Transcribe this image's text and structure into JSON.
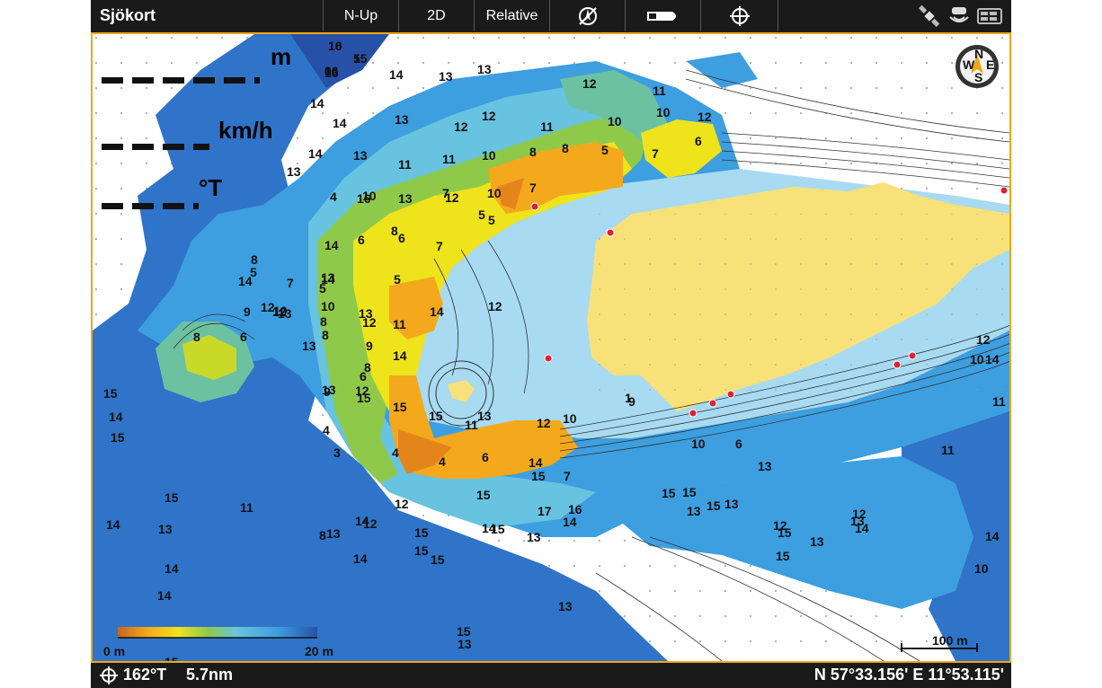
{
  "topbar": {
    "title": "Sjökort",
    "orientation_label": "N-Up",
    "view_label": "2D",
    "motion_label": "Relative",
    "icons": [
      "navigation-off-icon",
      "boat-icon",
      "crosshair-icon",
      "satellite-icon",
      "sonar-icon",
      "battery-icon"
    ]
  },
  "overlay": {
    "depth_unit": "m",
    "speed_unit": "km/h",
    "heading_unit": "°T"
  },
  "legend": {
    "min_label": "0 m",
    "max_label": "20 m",
    "colors": [
      "#c8641e",
      "#e4851c",
      "#f4a81c",
      "#f4c71c",
      "#efe31c",
      "#c9d92a",
      "#8fc94a",
      "#6cc2a0",
      "#67c3e0",
      "#3d9ee0",
      "#2f74c8",
      "#2751a8"
    ]
  },
  "scale": {
    "label": "100 m"
  },
  "statusbar": {
    "bearing": "162°T",
    "distance": "5.7nm",
    "position": "N 57°33.156' E 11°53.115'"
  },
  "compass": {
    "letters": [
      "N",
      "E",
      "S",
      "W"
    ]
  },
  "depth_labels": [
    "16",
    "16",
    "15",
    "16",
    "14",
    "13",
    "13",
    "12",
    "11",
    "14",
    "13",
    "12",
    "12",
    "11",
    "10",
    "10",
    "14",
    "14",
    "13",
    "11",
    "10",
    "8",
    "8",
    "5",
    "7",
    "6",
    "13",
    "11",
    "10",
    "7",
    "5",
    "4",
    "16",
    "13",
    "12",
    "10",
    "7",
    "5",
    "6",
    "6",
    "7",
    "8",
    "7",
    "14",
    "13",
    "10",
    "14",
    "13",
    "12",
    "8",
    "5",
    "13",
    "9",
    "8",
    "5",
    "14",
    "12",
    "13",
    "10",
    "9",
    "8",
    "6",
    "8",
    "8",
    "12",
    "11",
    "12",
    "5",
    "14",
    "14",
    "13",
    "12",
    "9",
    "6",
    "15",
    "15",
    "15",
    "13",
    "12",
    "10",
    "4",
    "3",
    "4",
    "4",
    "6",
    "14",
    "15",
    "7",
    "11",
    "8",
    "12",
    "12",
    "14",
    "15",
    "14",
    "13",
    "13",
    "15",
    "17",
    "16",
    "15",
    "14",
    "14",
    "15",
    "15",
    "14",
    "13",
    "13",
    "13",
    "15",
    "15",
    "14",
    "15",
    "15",
    "14",
    "14",
    "15",
    "15",
    "15",
    "15",
    "13",
    "13",
    "13",
    "12",
    "13",
    "12",
    "13",
    "11",
    "10",
    "14",
    "11",
    "10",
    "12",
    "14",
    "14",
    "15",
    "15",
    "12",
    "11",
    "10",
    "6",
    "1",
    "9",
    "10",
    "0",
    "5"
  ]
}
